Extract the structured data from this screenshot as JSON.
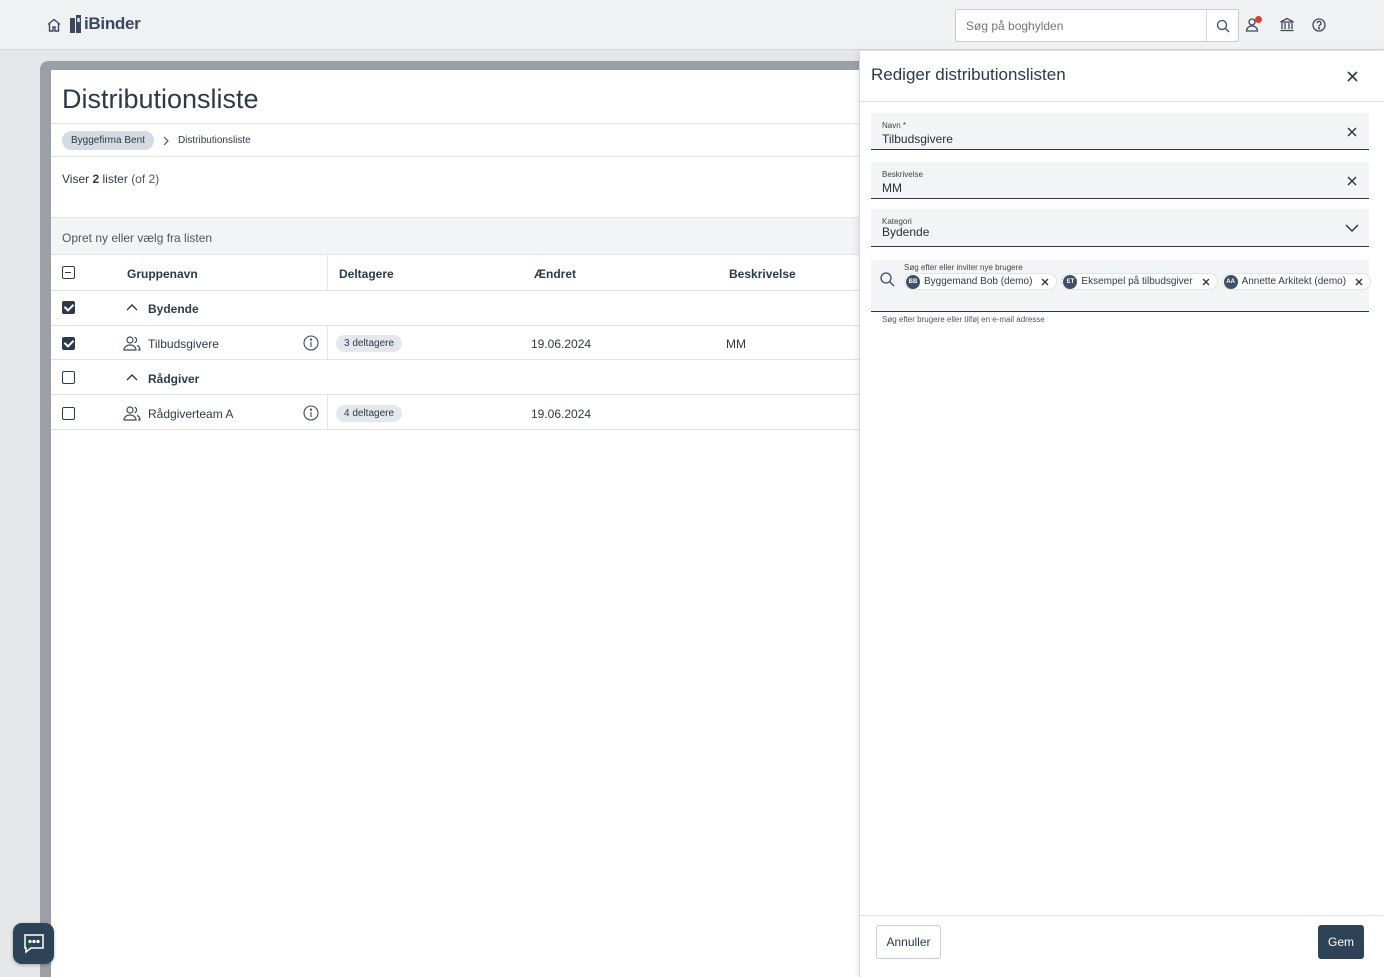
{
  "header": {
    "logo_text": "iBinder",
    "search_placeholder": "Søg på boghylden",
    "icons": [
      "home-icon",
      "search-icon",
      "user-notification-icon",
      "library-icon",
      "help-icon"
    ]
  },
  "main": {
    "title": "Distributionsliste",
    "breadcrumb": {
      "parent": "Byggefirma Bent",
      "current": "Distributionsliste"
    },
    "count": {
      "prefix": "Viser",
      "number": "2",
      "suffix": "lister",
      "total": "(of 2)"
    },
    "create_hint": "Opret ny eller vælg fra listen",
    "columns": {
      "name": "Gruppenavn",
      "participants": "Deltagere",
      "changed": "Ændret",
      "description": "Beskrivelse"
    },
    "groups": [
      {
        "label": "Bydende",
        "checked": true,
        "rows": [
          {
            "name": "Tilbudsgivere",
            "participants": "3 deltagere",
            "changed": "19.06.2024",
            "description": "MM",
            "checked": true
          }
        ]
      },
      {
        "label": "Rådgiver",
        "checked": false,
        "rows": [
          {
            "name": "Rådgiverteam A",
            "participants": "4 deltagere",
            "changed": "19.06.2024",
            "description": "",
            "checked": false
          }
        ]
      }
    ]
  },
  "panel": {
    "title": "Rediger distributionslisten",
    "name_field": {
      "label": "Navn *",
      "value": "Tilbudsgivere"
    },
    "description_field": {
      "label": "Beskrivelse",
      "value": "MM"
    },
    "category_field": {
      "label": "Kategori",
      "value": "Bydende"
    },
    "invite_field": {
      "label": "Søg efter eller inviter nye brugere",
      "chips": [
        {
          "initials": "BB",
          "label": "Byggemand Bob (demo)"
        },
        {
          "initials": "ET",
          "label": "Eksempel på tilbudsgiver"
        },
        {
          "initials": "AA",
          "label": "Annette Arkitekt (demo)"
        }
      ],
      "helper": "Søg efter brugere eller tilføj en e-mail adresse"
    },
    "cancel_label": "Annuller",
    "save_label": "Gem"
  },
  "colors": {
    "primary": "#2f4357",
    "notification": "#d9432f",
    "surface": "#f3f4f5"
  }
}
